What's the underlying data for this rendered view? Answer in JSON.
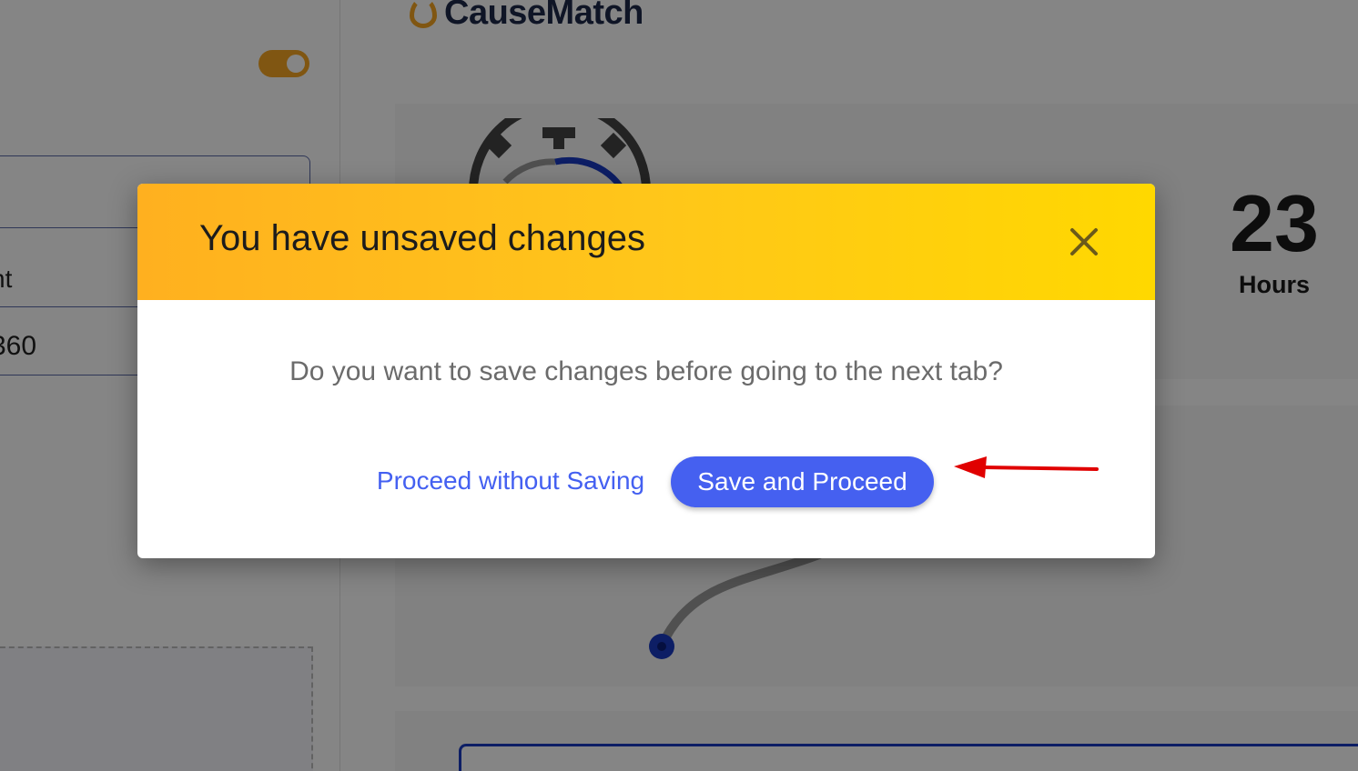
{
  "background": {
    "brand": {
      "name": "CauseMatch",
      "icon": "drop-logo-icon"
    },
    "left_panel": {
      "field_label_fragment": "nt",
      "field_value_fragment": "360"
    },
    "countdown": {
      "value": "23",
      "unit": "Hours"
    }
  },
  "modal": {
    "title": "You have unsaved changes",
    "close_icon": "close-icon",
    "message": "Do you want to save changes before going to the next tab?",
    "secondary_button": "Proceed without Saving",
    "primary_button": "Save and Proceed"
  },
  "annotation": {
    "arrow_color": "#e00000"
  },
  "colors": {
    "header_gradient_start": "#ffb01f",
    "header_gradient_end": "#ffd800",
    "primary": "#4560f0",
    "link": "#4460f1"
  }
}
